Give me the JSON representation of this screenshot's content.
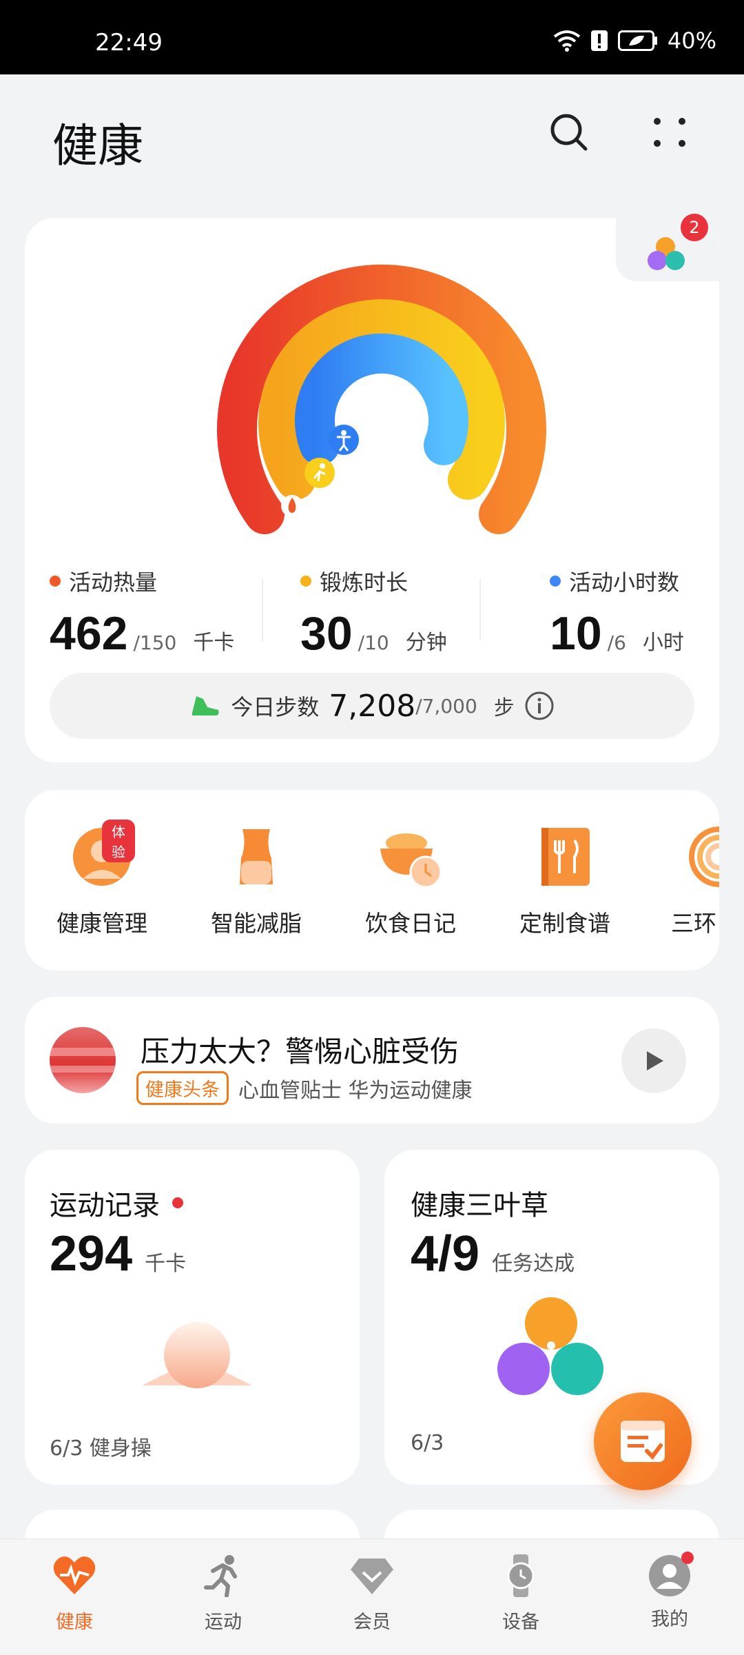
{
  "status_bar": {
    "time": "22:49",
    "battery": "40%"
  },
  "header": {
    "title": "健康"
  },
  "activity_rings": {
    "notification_count": "2",
    "calories": {
      "label": "活动热量",
      "value": "462",
      "goal": "/150",
      "unit": "千卡",
      "color": "#f05a2a"
    },
    "exercise": {
      "label": "锻炼时长",
      "value": "30",
      "goal": "/10",
      "unit": "分钟",
      "color": "#f6b21b"
    },
    "stand": {
      "label": "活动小时数",
      "value": "10",
      "goal": "/6",
      "unit": "小时",
      "color": "#3d86f5"
    },
    "steps": {
      "label": "今日步数",
      "value": "7,208",
      "goal": "/7,000",
      "unit": "步"
    }
  },
  "shortcuts": [
    {
      "label": "健康管理",
      "badge": "体验",
      "icon": "doctor-icon"
    },
    {
      "label": "智能减脂",
      "icon": "body-shape-icon"
    },
    {
      "label": "饮食日记",
      "icon": "meal-bowl-icon"
    },
    {
      "label": "定制食谱",
      "icon": "recipe-book-icon"
    },
    {
      "label": "三环",
      "icon": "rings-icon"
    }
  ],
  "news": {
    "title": "压力太大？警惕心脏受伤",
    "tag": "健康头条",
    "source": "心血管贴士  华为运动健康"
  },
  "exercise_record": {
    "title": "运动记录",
    "value": "294",
    "unit": "千卡",
    "footer": "6/3  健身操"
  },
  "clover": {
    "title": "健康三叶草",
    "value": "4/9",
    "unit": "任务达成",
    "footer": "6/3"
  },
  "nav": [
    {
      "label": "健康",
      "icon": "heart-pulse-icon",
      "active": true
    },
    {
      "label": "运动",
      "icon": "runner-icon"
    },
    {
      "label": "会员",
      "icon": "diamond-icon"
    },
    {
      "label": "设备",
      "icon": "watch-icon"
    },
    {
      "label": "我的",
      "icon": "avatar-icon"
    }
  ],
  "colors": {
    "accent": "#f36b24",
    "background": "#f2f3f5"
  }
}
